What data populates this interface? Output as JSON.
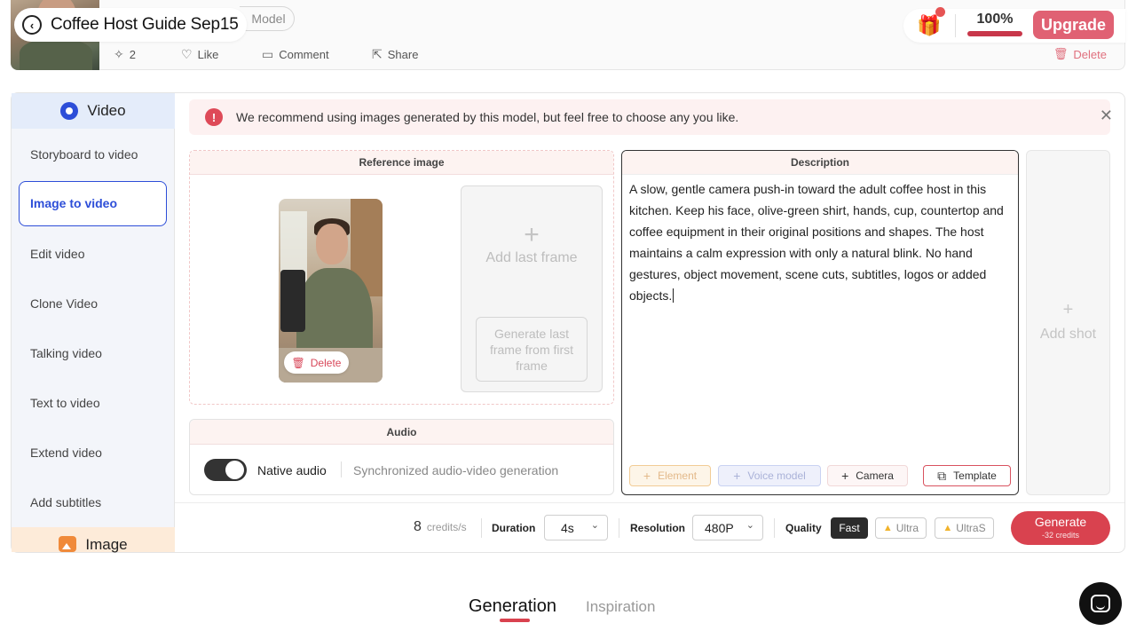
{
  "header": {
    "title": "Coffee Host Guide Sep15",
    "model_label": "Model",
    "actions": {
      "sparkle_count": "2",
      "like": "Like",
      "comment": "Comment",
      "share": "Share",
      "delete": "Delete"
    },
    "usage_percent": "100%",
    "upgrade": "Upgrade"
  },
  "sidebar": {
    "section_video": "Video",
    "items": [
      {
        "label": "Storyboard to video"
      },
      {
        "label": "Image to video"
      },
      {
        "label": "Edit video"
      },
      {
        "label": "Clone Video"
      },
      {
        "label": "Talking video"
      },
      {
        "label": "Text to video"
      },
      {
        "label": "Extend video"
      },
      {
        "label": "Add subtitles"
      }
    ],
    "section_image": "Image"
  },
  "banner": {
    "text": "We recommend using images generated by this model, but feel free to choose any you like."
  },
  "reference": {
    "header": "Reference image",
    "delete": "Delete",
    "add_last_frame": "Add last frame",
    "generate_last_frame": "Generate last frame from first frame"
  },
  "audio": {
    "header": "Audio",
    "native": "Native audio",
    "sync": "Synchronized audio-video generation"
  },
  "description": {
    "header": "Description",
    "text": "A slow, gentle camera push-in toward the adult coffee host in this kitchen. Keep his face, olive-green shirt, hands, cup, countertop and coffee equipment in their original positions and shapes. The host maintains a calm expression with only a natural blink. No hand gestures, object movement, scene cuts, subtitles, logos or added objects.",
    "chips": {
      "element": "Element",
      "voice_model": "Voice model",
      "camera": "Camera",
      "template": "Template"
    }
  },
  "add_shot": "Add shot",
  "settings": {
    "credits": "8",
    "credits_unit": "credits/s",
    "duration_label": "Duration",
    "duration_value": "4s",
    "resolution_label": "Resolution",
    "resolution_value": "480P",
    "quality_label": "Quality",
    "quality_options": [
      "Fast",
      "Ultra",
      "UltraS"
    ],
    "generate": "Generate",
    "generate_cost": "-32 credits"
  },
  "tabs": {
    "generation": "Generation",
    "inspiration": "Inspiration"
  },
  "colors": {
    "accent": "#d9424f",
    "active_blue": "#2d4ed8"
  }
}
